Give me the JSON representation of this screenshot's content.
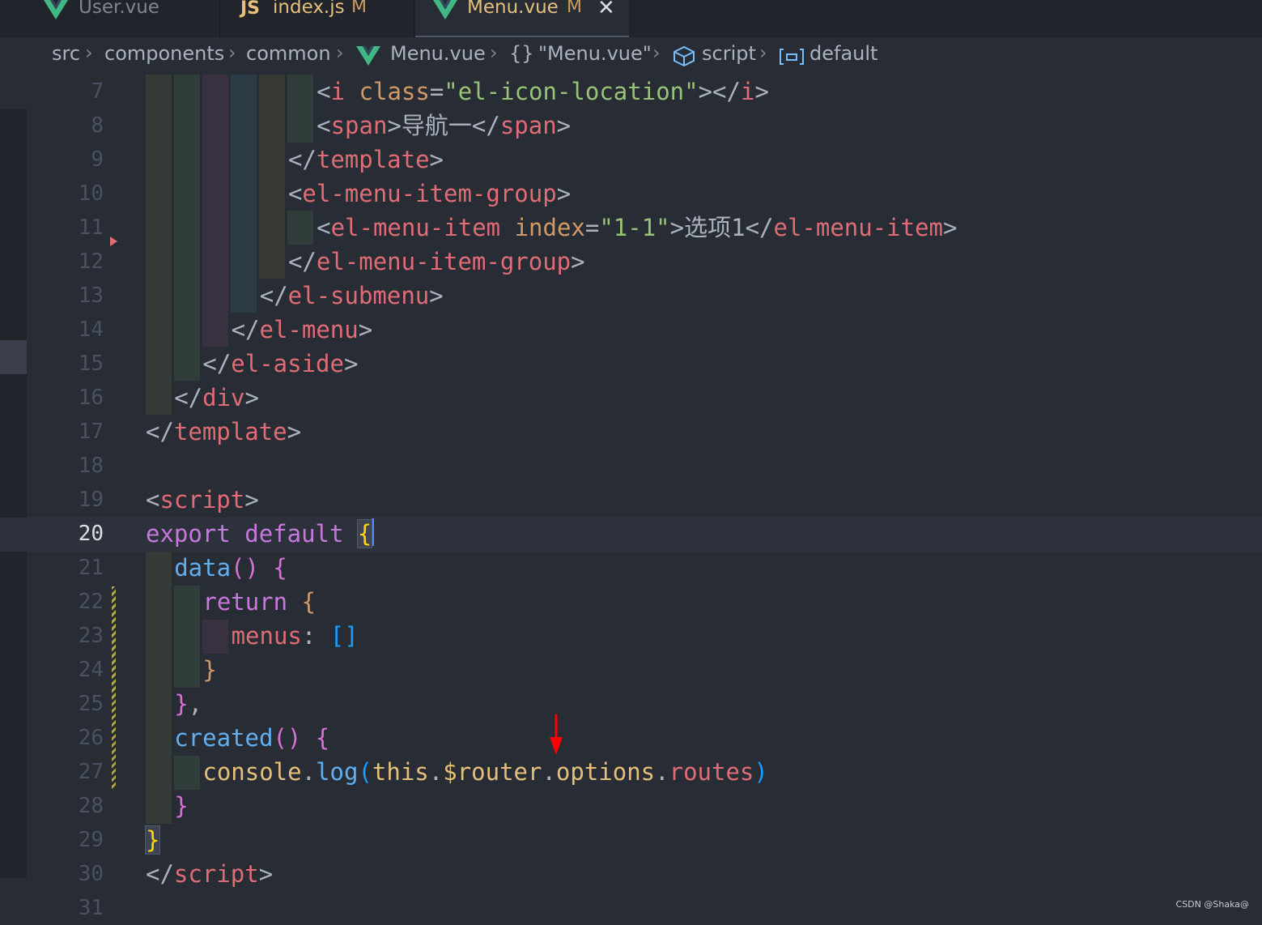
{
  "tabs": [
    {
      "name": "User.vue",
      "modified": "",
      "icon": "vue-icon",
      "active": false
    },
    {
      "name": "index.js",
      "modified": "M",
      "icon": "js-icon",
      "icon_text": "JS",
      "active": false
    },
    {
      "name": "Menu.vue",
      "modified": "M",
      "icon": "vue-icon",
      "active": true,
      "close_glyph": "✕"
    }
  ],
  "breadcrumb": {
    "items": [
      "src",
      "components",
      "common",
      "Menu.vue",
      "{}",
      "\"Menu.vue\"",
      "script",
      "default"
    ],
    "separator": "›"
  },
  "editor": {
    "current_line": 20,
    "line_numbers": [
      "7",
      "8",
      "9",
      "10",
      "11",
      "12",
      "13",
      "14",
      "15",
      "16",
      "17",
      "18",
      "19",
      "20",
      "21",
      "22",
      "23",
      "24",
      "25",
      "26",
      "27",
      "28",
      "29",
      "30",
      "31"
    ],
    "tokens": {
      "l7": [
        "<",
        "i",
        " class",
        "=",
        "\"el-icon-location\"",
        "></",
        "i",
        ">"
      ],
      "l8": [
        "<",
        "span",
        ">导航一</",
        "span",
        ">"
      ],
      "l9": [
        "</",
        "template",
        ">"
      ],
      "l10": [
        "<",
        "el-menu-item-group",
        ">"
      ],
      "l11": [
        "<",
        "el-menu-item",
        " index",
        "=",
        "\"1-1\"",
        ">选项1</",
        "el-menu-item",
        ">"
      ],
      "l12": [
        "</",
        "el-menu-item-group",
        ">"
      ],
      "l13": [
        "</",
        "el-submenu",
        ">"
      ],
      "l14": [
        "</",
        "el-menu",
        ">"
      ],
      "l15": [
        "</",
        "el-aside",
        ">"
      ],
      "l16": [
        "</",
        "div",
        ">"
      ],
      "l17": [
        "</",
        "template",
        ">"
      ],
      "l19": [
        "<",
        "script",
        ">"
      ],
      "l20": [
        "export",
        " ",
        "default",
        " ",
        "{"
      ],
      "l21": [
        "data",
        "()",
        " ",
        "{"
      ],
      "l22": [
        "return",
        " ",
        "{"
      ],
      "l23": [
        "menus",
        ": ",
        "[]"
      ],
      "l24": [
        "}"
      ],
      "l25": [
        "}",
        ","
      ],
      "l26": [
        "created",
        "()",
        " ",
        "{"
      ],
      "l27": [
        "console",
        ".",
        "log",
        "(",
        "this",
        ".",
        "$router",
        ".",
        "options",
        ".",
        "routes",
        ")"
      ],
      "l28": [
        "}"
      ],
      "l29": [
        "}"
      ],
      "l30": [
        "</",
        "script",
        ">"
      ]
    }
  },
  "colors": {
    "background": "#282c34",
    "tag": "#e06c75",
    "attribute": "#d19a66",
    "string": "#98c379",
    "keyword": "#c678dd",
    "function": "#61afef",
    "annotation_arrow": "#ff0000"
  },
  "watermark": "CSDN @Shaka@"
}
